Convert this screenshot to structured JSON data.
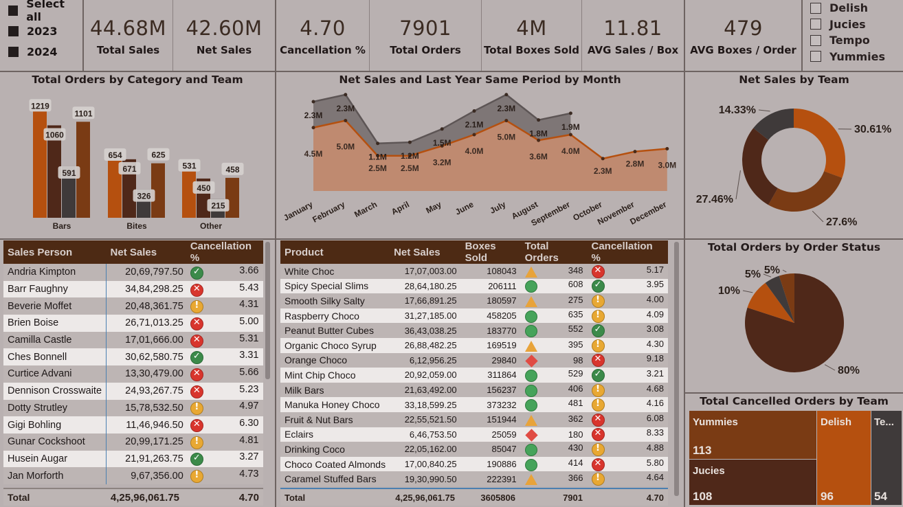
{
  "year_slicer": {
    "items": [
      "Select all",
      "2023",
      "2024"
    ]
  },
  "team_slicer": {
    "items": [
      "Delish",
      "Jucies",
      "Tempo",
      "Yummies"
    ]
  },
  "kpis": [
    {
      "value": "44.68M",
      "label": "Total Sales"
    },
    {
      "value": "42.60M",
      "label": "Net Sales"
    },
    {
      "value": "4.70",
      "label": "Cancellation %"
    },
    {
      "value": "7901",
      "label": "Total Orders"
    },
    {
      "value": "4M",
      "label": "Total Boxes Sold"
    },
    {
      "value": "11.81",
      "label": "AVG Sales / Box"
    },
    {
      "value": "479",
      "label": "AVG Boxes / Order"
    }
  ],
  "titles": {
    "orders_cat": "Total Orders by Category and Team",
    "net_sales_month": "Net Sales and Last Year Same Period by Month",
    "net_sales_team": "Net Sales by Team",
    "order_status": "Total Orders by Order Status",
    "cancelled_team": "Total Cancelled Orders by Team"
  },
  "colors": {
    "c1": "#b5500f",
    "c2": "#4f2819",
    "c3": "#3f3a3a",
    "c4": "#7a3b14"
  },
  "chart_data": [
    {
      "type": "bar",
      "title": "Total Orders by Category and Team",
      "categories": [
        "Bars",
        "Bites",
        "Other"
      ],
      "series": [
        {
          "values": [
            1219,
            654,
            531
          ]
        },
        {
          "values": [
            1060,
            671,
            450
          ]
        },
        {
          "values": [
            591,
            326,
            215
          ]
        },
        {
          "values": [
            1101,
            625,
            458
          ]
        }
      ]
    },
    {
      "type": "area",
      "title": "Net Sales and Last Year Same Period by Month",
      "categories": [
        "January",
        "February",
        "March",
        "April",
        "May",
        "June",
        "July",
        "August",
        "September",
        "October",
        "November",
        "December"
      ],
      "series": [
        {
          "values": [
            4.5,
            5.0,
            2.5,
            2.5,
            3.2,
            4.0,
            5.0,
            3.6,
            4.0,
            2.3,
            2.8,
            3.0
          ],
          "labels": [
            "4.5M",
            "5.0M",
            "2.5M",
            "2.5M",
            "3.2M",
            "4.0M",
            "5.0M",
            "3.6M",
            "4.0M",
            "2.3M",
            "2.8M",
            "3.0M"
          ]
        },
        {
          "values": [
            2.3,
            2.3,
            1.1,
            1.2,
            1.5,
            2.1,
            2.3,
            1.8,
            1.9
          ],
          "labels": [
            "2.3M",
            "2.3M",
            "1.1M",
            "1.2M",
            "1.5M",
            "2.1M",
            "2.3M",
            "1.8M",
            "1.9M"
          ]
        }
      ]
    },
    {
      "type": "pie",
      "title": "Net Sales by Team",
      "values": [
        30.61,
        27.6,
        27.46,
        14.33
      ],
      "labels": [
        "30.61%",
        "27.6%",
        "27.46%",
        "14.33%"
      ]
    },
    {
      "type": "pie",
      "title": "Total Orders by Order Status",
      "values": [
        80,
        10,
        5,
        5
      ],
      "labels": [
        "80%",
        "10%",
        "5%",
        "5%"
      ]
    }
  ],
  "sales_table": {
    "headers": [
      "Sales Person",
      "Net Sales",
      "Cancellation %"
    ],
    "rows": [
      [
        "Andria Kimpton",
        "20,69,797.50",
        "ok",
        "3.66"
      ],
      [
        "Barr Faughny",
        "34,84,298.25",
        "x",
        "5.43"
      ],
      [
        "Beverie Moffet",
        "20,48,361.75",
        "warn",
        "4.31"
      ],
      [
        "Brien Boise",
        "26,71,013.25",
        "x",
        "5.00"
      ],
      [
        "Camilla Castle",
        "17,01,666.00",
        "x",
        "5.31"
      ],
      [
        "Ches Bonnell",
        "30,62,580.75",
        "ok",
        "3.31"
      ],
      [
        "Curtice Advani",
        "13,30,479.00",
        "x",
        "5.66"
      ],
      [
        "Dennison Crosswaite",
        "24,93,267.75",
        "x",
        "5.23"
      ],
      [
        "Dotty Strutley",
        "15,78,532.50",
        "warn",
        "4.97"
      ],
      [
        "Gigi Bohling",
        "11,46,946.50",
        "x",
        "6.30"
      ],
      [
        "Gunar Cockshoot",
        "20,99,171.25",
        "warn",
        "4.81"
      ],
      [
        "Husein Augar",
        "21,91,263.75",
        "ok",
        "3.27"
      ],
      [
        "Jan Morforth",
        "9,67,356.00",
        "warn",
        "4.73"
      ]
    ],
    "total": [
      "Total",
      "4,25,96,061.75",
      "4.70"
    ]
  },
  "product_table": {
    "headers": [
      "Product",
      "Net Sales",
      "Boxes Sold",
      "Total Orders",
      "Cancellation %"
    ],
    "rows": [
      [
        "White Choc",
        "17,07,003.00",
        "108043",
        "tri",
        "348",
        "x",
        "5.17"
      ],
      [
        "Spicy Special Slims",
        "28,64,180.25",
        "206111",
        "circ",
        "608",
        "ok",
        "3.95"
      ],
      [
        "Smooth Silky Salty",
        "17,66,891.25",
        "180597",
        "tri",
        "275",
        "warn",
        "4.00"
      ],
      [
        "Raspberry Choco",
        "31,27,185.00",
        "458205",
        "circ",
        "635",
        "warn",
        "4.09"
      ],
      [
        "Peanut Butter Cubes",
        "36,43,038.25",
        "183770",
        "circ",
        "552",
        "ok",
        "3.08"
      ],
      [
        "Organic Choco Syrup",
        "26,88,482.25",
        "169519",
        "tri",
        "395",
        "warn",
        "4.30"
      ],
      [
        "Orange Choco",
        "6,12,956.25",
        "29840",
        "diam",
        "98",
        "x",
        "9.18"
      ],
      [
        "Mint Chip Choco",
        "20,92,059.00",
        "311864",
        "circ",
        "529",
        "ok",
        "3.21"
      ],
      [
        "Milk Bars",
        "21,63,492.00",
        "156237",
        "circ",
        "406",
        "warn",
        "4.68"
      ],
      [
        "Manuka Honey Choco",
        "33,18,599.25",
        "373232",
        "circ",
        "481",
        "warn",
        "4.16"
      ],
      [
        "Fruit & Nut Bars",
        "22,55,521.50",
        "151944",
        "tri",
        "362",
        "x",
        "6.08"
      ],
      [
        "Eclairs",
        "6,46,753.50",
        "25059",
        "diam",
        "180",
        "x",
        "8.33"
      ],
      [
        "Drinking Coco",
        "22,05,162.00",
        "85047",
        "circ",
        "430",
        "warn",
        "4.88"
      ],
      [
        "Choco Coated Almonds",
        "17,00,840.25",
        "190886",
        "circ",
        "414",
        "x",
        "5.80"
      ],
      [
        "Caramel Stuffed Bars",
        "19,30,990.50",
        "222391",
        "tri",
        "366",
        "warn",
        "4.64"
      ]
    ],
    "total": [
      "Total",
      "4,25,96,061.75",
      "3605806",
      "7901",
      "4.70"
    ]
  },
  "treemap": {
    "items": [
      {
        "name": "Yummies",
        "value": "113"
      },
      {
        "name": "Jucies",
        "value": "108"
      },
      {
        "name": "Delish",
        "value": "96"
      },
      {
        "name": "Te...",
        "value": "54"
      }
    ]
  }
}
